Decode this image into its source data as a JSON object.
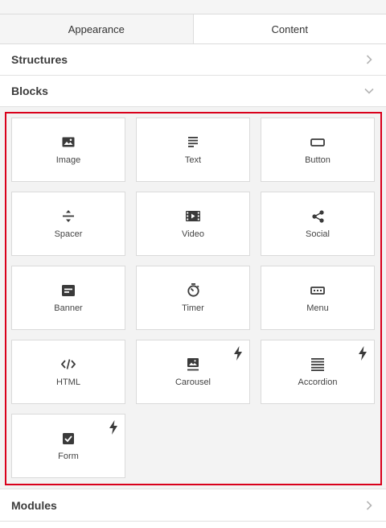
{
  "tabs": [
    {
      "label": "Appearance",
      "active": false
    },
    {
      "label": "Content",
      "active": true
    }
  ],
  "sections": {
    "structures": {
      "label": "Structures",
      "chevron": "chevron-right-icon"
    },
    "blocks": {
      "label": "Blocks",
      "chevron": "chevron-down-icon",
      "expanded": true
    },
    "modules": {
      "label": "Modules",
      "chevron": "chevron-right-icon"
    }
  },
  "blocks": [
    {
      "label": "Image",
      "icon": "image-icon",
      "premium": false
    },
    {
      "label": "Text",
      "icon": "text-icon",
      "premium": false
    },
    {
      "label": "Button",
      "icon": "button-icon",
      "premium": false
    },
    {
      "label": "Spacer",
      "icon": "spacer-icon",
      "premium": false
    },
    {
      "label": "Video",
      "icon": "video-icon",
      "premium": false
    },
    {
      "label": "Social",
      "icon": "share-icon",
      "premium": false
    },
    {
      "label": "Banner",
      "icon": "banner-icon",
      "premium": false
    },
    {
      "label": "Timer",
      "icon": "timer-icon",
      "premium": false
    },
    {
      "label": "Menu",
      "icon": "menu-icon",
      "premium": false
    },
    {
      "label": "HTML",
      "icon": "code-icon",
      "premium": false
    },
    {
      "label": "Carousel",
      "icon": "carousel-icon",
      "premium": true
    },
    {
      "label": "Accordion",
      "icon": "accordion-icon",
      "premium": true
    },
    {
      "label": "Form",
      "icon": "form-icon",
      "premium": true
    }
  ],
  "colors": {
    "highlight": "#d9001b",
    "icon": "#3a3a3a"
  }
}
